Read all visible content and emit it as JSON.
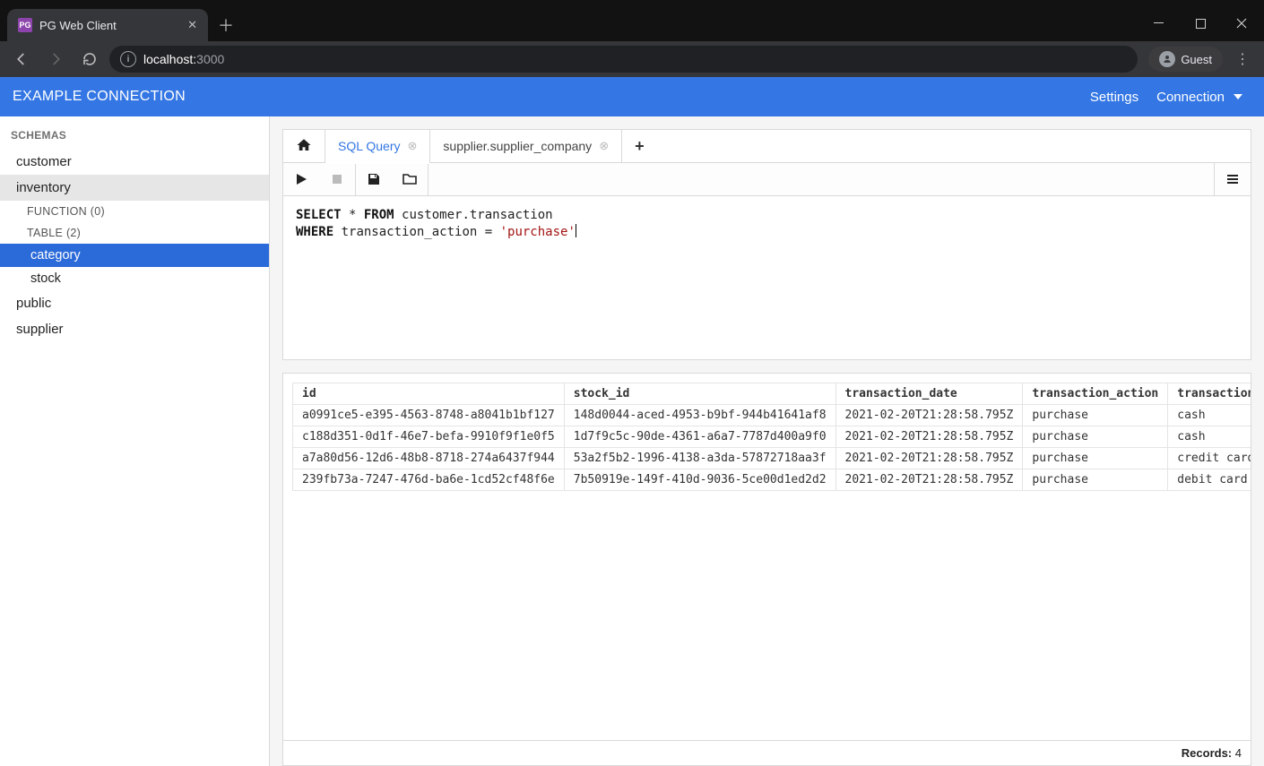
{
  "browser": {
    "tab_title": "PG Web Client",
    "url_host": "localhost:",
    "url_rest": "3000",
    "guest_label": "Guest"
  },
  "app": {
    "header": {
      "title": "EXAMPLE CONNECTION",
      "settings_label": "Settings",
      "connection_label": "Connection"
    },
    "sidebar": {
      "section_label": "SCHEMAS",
      "schemas": [
        {
          "name": "customer",
          "expanded": false
        },
        {
          "name": "inventory",
          "expanded": true,
          "func_label": "FUNCTION (0)",
          "table_label": "TABLE (2)",
          "tables": [
            "category",
            "stock"
          ],
          "selected_table": "category"
        },
        {
          "name": "public",
          "expanded": false
        },
        {
          "name": "supplier",
          "expanded": false
        }
      ]
    },
    "tabs": {
      "sql_label": "SQL Query",
      "other_label": "supplier.supplier_company"
    },
    "query": {
      "line1_a": "SELECT",
      "line1_b": " * ",
      "line1_c": "FROM",
      "line1_d": " customer.transaction",
      "line2_a": "WHERE",
      "line2_b": " transaction_action = ",
      "line2_c": "'purchase'"
    },
    "results": {
      "columns": [
        "id",
        "stock_id",
        "transaction_date",
        "transaction_action",
        "transaction_facilitator"
      ],
      "rows": [
        [
          "a0991ce5-e395-4563-8748-a8041b1bf127",
          "148d0044-aced-4953-b9bf-944b41641af8",
          "2021-02-20T21:28:58.795Z",
          "purchase",
          "cash"
        ],
        [
          "c188d351-0d1f-46e7-befa-9910f9f1e0f5",
          "1d7f9c5c-90de-4361-a6a7-7787d400a9f0",
          "2021-02-20T21:28:58.795Z",
          "purchase",
          "cash"
        ],
        [
          "a7a80d56-12d6-48b8-8718-274a6437f944",
          "53a2f5b2-1996-4138-a3da-57872718aa3f",
          "2021-02-20T21:28:58.795Z",
          "purchase",
          "credit card"
        ],
        [
          "239fb73a-7247-476d-ba6e-1cd52cf48f6e",
          "7b50919e-149f-410d-9036-5ce00d1ed2d2",
          "2021-02-20T21:28:58.795Z",
          "purchase",
          "debit card"
        ]
      ],
      "status_label": "Records:",
      "status_value": "4"
    }
  }
}
